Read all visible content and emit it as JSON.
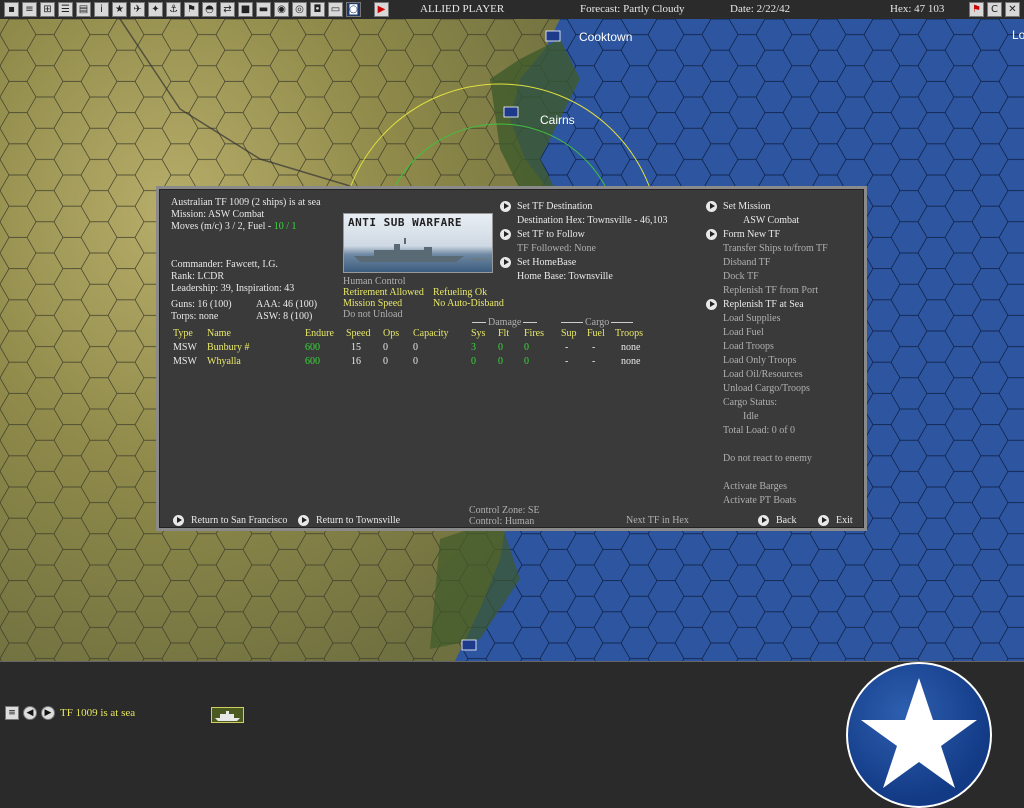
{
  "topbar": {
    "player": "ALLIED PLAYER",
    "forecast": "Forecast: Partly Cloudy",
    "date": "Date: 2/22/42",
    "hex": "Hex: 47 103",
    "right_icons": [
      "flag-icon",
      "c-icon",
      "close-icon"
    ]
  },
  "map_labels": {
    "cooktown": "Cooktown",
    "cairns": "Cairns",
    "edge": "Lo"
  },
  "tf": {
    "title": "Australian TF 1009 (2 ships) is at sea",
    "mission": "Mission:  ASW Combat",
    "moves_prefix": "Moves (m/c)  3 / 2, Fuel - ",
    "fuel": "10 / 1",
    "commander": "Commander: Fawcett, I.G.",
    "rank": "Rank: LCDR",
    "leadership": "Leadership: 39, Inspiration: 43",
    "guns": "Guns: 16 (100)",
    "aaa": "AAA: 46 (100)",
    "torps": "Torps: none",
    "asw": "ASW: 8 (100)",
    "mission_image_title": "ANTI SUB WARFARE",
    "human_control": "Human Control",
    "retirement": "Retirement Allowed",
    "refueling": "Refueling Ok",
    "mission_speed": "Mission Speed",
    "auto_disband": "No Auto-Disband",
    "unload": "Do not Unload"
  },
  "mid_actions": {
    "set_destination": "Set TF Destination",
    "destination_hex": "Destination Hex: Townsville - 46,103",
    "set_follow": "Set TF to Follow",
    "followed": "TF Followed: None",
    "set_homebase": "Set HomeBase",
    "home_base": "Home Base: Townsville"
  },
  "right_actions": {
    "set_mission": "Set Mission",
    "mission_value": "ASW Combat",
    "form_new": "Form New TF",
    "transfer": "Transfer Ships to/from TF",
    "disband": "Disband TF",
    "dock": "Dock TF",
    "replenish_port": "Replenish TF from Port",
    "replenish_sea": "Replenish TF at Sea",
    "load_supplies": "Load Supplies",
    "load_fuel": "Load Fuel",
    "load_troops": "Load Troops",
    "load_only_troops": "Load Only Troops",
    "load_oil": "Load Oil/Resources",
    "unload_cargo": "Unload Cargo/Troops",
    "cargo_status": "Cargo Status:",
    "cargo_idle": "Idle",
    "total_load": "Total Load: 0 of 0",
    "react": "Do not react to enemy",
    "barges": "Activate Barges",
    "pt_boats": "Activate PT Boats"
  },
  "table": {
    "group_damage": "Damage",
    "group_cargo": "Cargo",
    "headers": [
      "Type",
      "Name",
      "Endure",
      "Speed",
      "Ops",
      "Capacity",
      "Sys",
      "Flt",
      "Fires",
      "Sup",
      "Fuel",
      "Troops"
    ],
    "rows": [
      [
        "MSW",
        "Bunbury #",
        "600",
        "15",
        "0",
        "0",
        "3",
        "0",
        "0",
        "-",
        "-",
        "none"
      ],
      [
        "MSW",
        "Whyalla",
        "600",
        "16",
        "0",
        "0",
        "0",
        "0",
        "0",
        "-",
        "-",
        "none"
      ]
    ]
  },
  "footer": {
    "return_sf": "Return to San Francisco",
    "return_townsville": "Return to Townsville",
    "control_zone": "Control Zone: SE",
    "control": "Control:    Human",
    "next_tf": "Next TF in Hex",
    "back": "Back",
    "exit": "Exit"
  },
  "bottom": {
    "status": "TF 1009 is at sea"
  }
}
